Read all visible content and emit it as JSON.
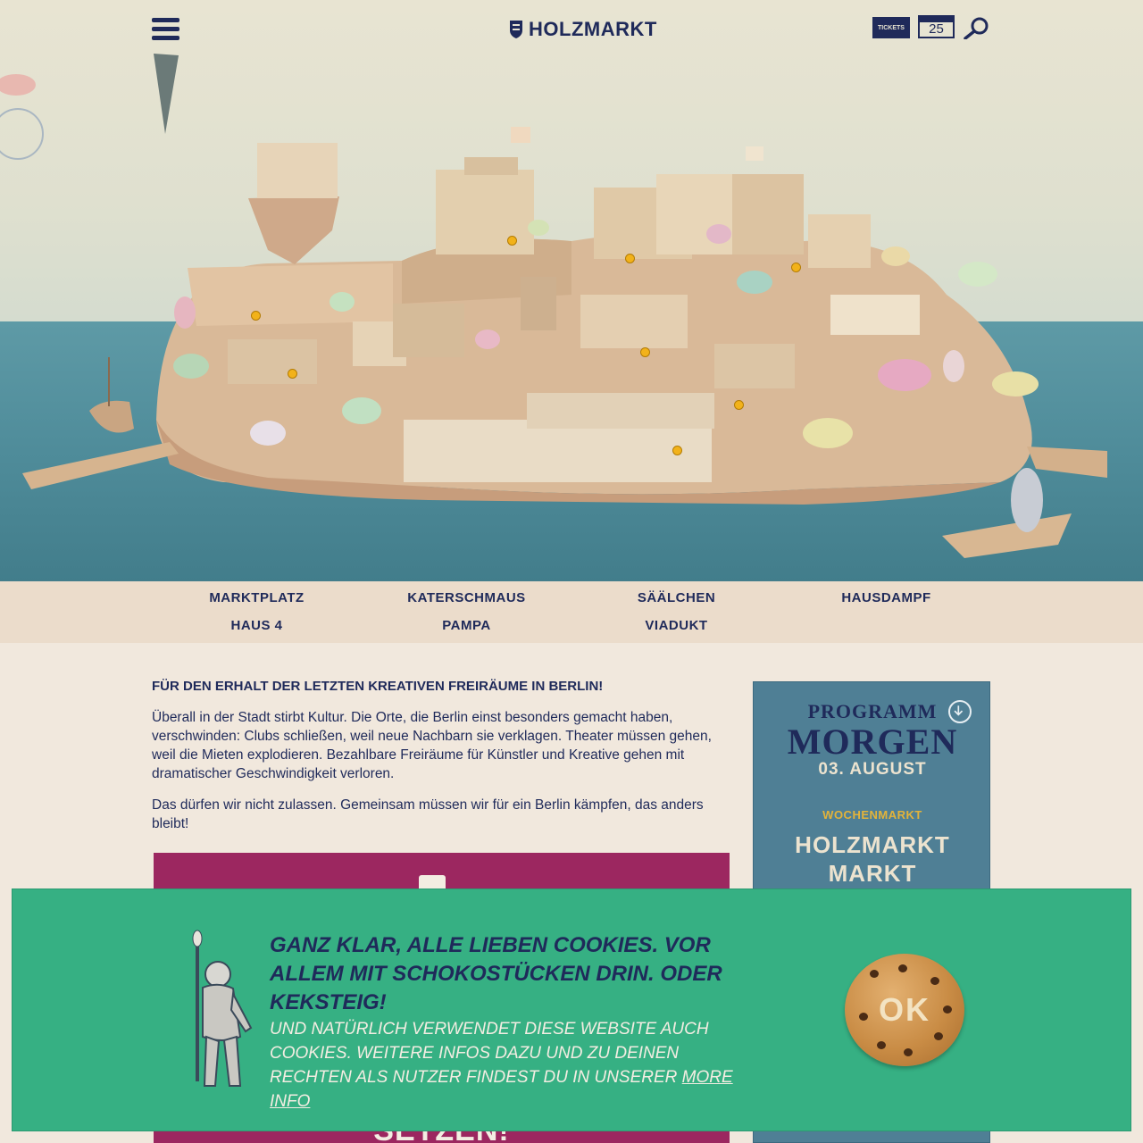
{
  "header": {
    "logo_text": "HOLZMARKT",
    "tickets_label": "TICKETS",
    "calendar_day": "25"
  },
  "areas": [
    "MARKTPLATZ",
    "KATERSCHMAUS",
    "SÄÄLCHEN",
    "HAUSDAMPF",
    "HAUS 4",
    "PAMPA",
    "VIADUKT"
  ],
  "main": {
    "headline": "FÜR DEN ERHALT DER LETZTEN KREATIVEN FREIRÄUME IN BERLIN!",
    "paragraph_1": "Überall in der Stadt stirbt Kultur. Die Orte, die Berlin einst besonders gemacht haben, verschwinden: Clubs schließen, weil neue Nachbarn sie verklagen. Theater müssen gehen, weil die Mieten explodieren. Bezahlbare Freiräume für Künstler und Kreative gehen mit dramatischer Geschwindigkeit verloren.",
    "paragraph_2": "Das dürfen wir nicht zulassen. Gemeinsam müssen wir für ein Berlin kämpfen, das anders bleibt!",
    "banner_text": "SETZEN!"
  },
  "program": {
    "label": "PROGRAMM",
    "day": "MORGEN",
    "date": "03. AUGUST",
    "category": "WOCHENMARKT",
    "title_line_1": "HOLZMARKT",
    "title_line_2": "MARKT"
  },
  "cookie": {
    "heading": "GANZ KLAR, ALLE LIEBEN COOKIES. VOR ALLEM MIT SCHOKOSTÜCKEN DRIN. ODER KEKSTEIG!",
    "body": "UND NATÜRLICH VERWENDET DIESE WEBSITE AUCH COOKIES. WEITERE INFOS DAZU UND ZU DEINEN RECHTEN ALS NUTZER FINDEST DU IN UNSERER",
    "more_info": "MORE INFO",
    "ok_label": "OK"
  },
  "colors": {
    "navy": "#1f2a5a",
    "sea": "#4f8c9a",
    "nav_bg": "#ebdccb",
    "program_bg": "#4f7f95",
    "cookie_bg": "#36b083",
    "banner_bg": "#9c2760",
    "hotspot": "#f2b21a"
  }
}
